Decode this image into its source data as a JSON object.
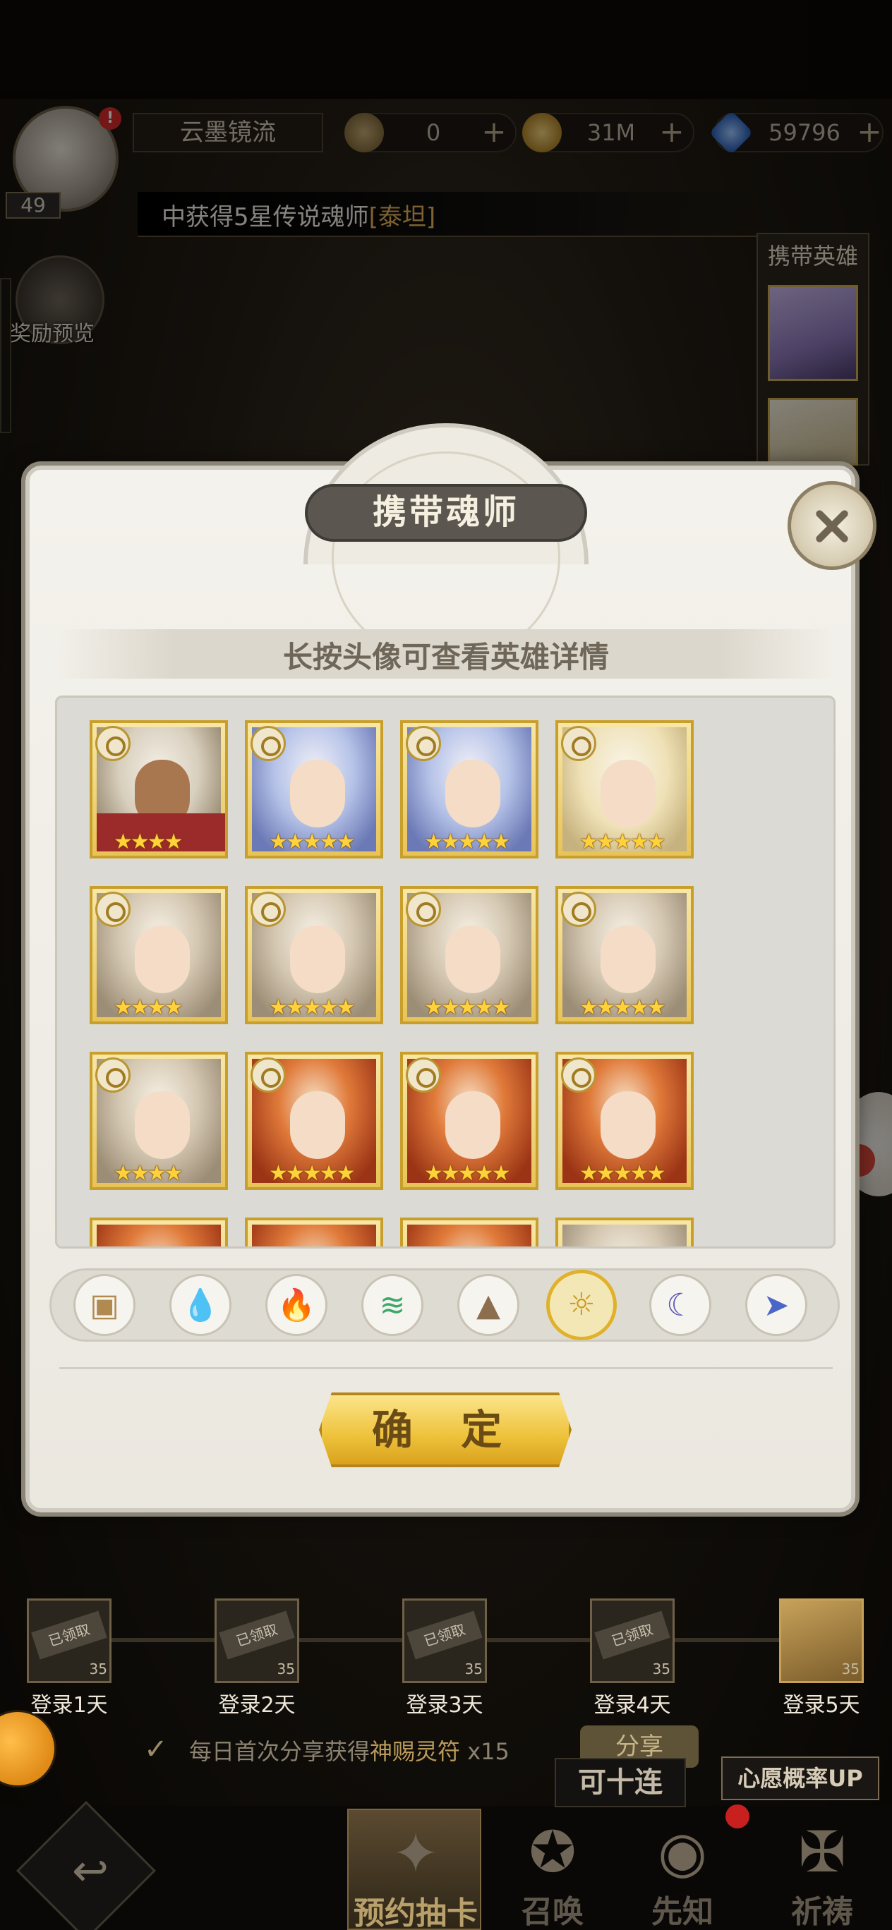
{
  "player": {
    "name": "云墨镜流",
    "level": "49"
  },
  "resources": [
    {
      "icon": "token-coin-icon",
      "value": "0",
      "color": "#8f7a4d"
    },
    {
      "icon": "gold-coin-icon",
      "value": "31M",
      "color": "#b8923c"
    },
    {
      "icon": "diamond-icon",
      "value": "59796",
      "color": "#4f8bd6"
    }
  ],
  "ticker": {
    "prefix": "中获得5星传说魂师",
    "highlight": "[泰坦]"
  },
  "reward_preview": {
    "label": "奖励预览"
  },
  "side_panel": {
    "title": "携带英雄"
  },
  "modal": {
    "title": "携带魂师",
    "hint": "长按头像可查看英雄详情",
    "confirm_label": "确 定",
    "heroes": [
      {
        "portrait": "white-haired-warrior",
        "stars": "★★★★",
        "element": "light"
      },
      {
        "portrait": "blue-haired-girl",
        "stars": "★★★★★",
        "element": "light"
      },
      {
        "portrait": "blue-haired-girl",
        "stars": "★★★★★",
        "element": "light"
      },
      {
        "portrait": "blonde-girl",
        "stars": "★★★★★",
        "element": "light"
      },
      {
        "portrait": "silver-haired-man",
        "stars": "★★★★",
        "element": "light"
      },
      {
        "portrait": "silver-haired-man",
        "stars": "★★★★★",
        "element": "light"
      },
      {
        "portrait": "silver-haired-man",
        "stars": "★★★★★",
        "element": "light"
      },
      {
        "portrait": "silver-haired-man",
        "stars": "★★★★★",
        "element": "light"
      },
      {
        "portrait": "silver-haired-man",
        "stars": "★★★★",
        "element": "light"
      },
      {
        "portrait": "red-haired-man",
        "stars": "★★★★★",
        "element": "light"
      },
      {
        "portrait": "red-haired-man",
        "stars": "★★★★★",
        "element": "light"
      },
      {
        "portrait": "red-haired-man",
        "stars": "★★★★★",
        "element": "light"
      }
    ],
    "filters": [
      {
        "name": "all-box-icon",
        "glyph": "▣",
        "color": "#b08a4e",
        "active": false
      },
      {
        "name": "water-drop-icon",
        "glyph": "💧",
        "color": "#3b7ed6",
        "active": false
      },
      {
        "name": "fire-icon",
        "glyph": "🔥",
        "color": "#d84a3a",
        "active": false
      },
      {
        "name": "wind-icon",
        "glyph": "≋",
        "color": "#3aa86a",
        "active": false
      },
      {
        "name": "earth-mountain-icon",
        "glyph": "▲",
        "color": "#8c6e4e",
        "active": false
      },
      {
        "name": "light-sun-icon",
        "glyph": "☼",
        "color": "#c79a22",
        "active": true
      },
      {
        "name": "dark-moon-icon",
        "glyph": "☾",
        "color": "#5a58b6",
        "active": false
      },
      {
        "name": "special-arrow-icon",
        "glyph": "➤",
        "color": "#4a66c8",
        "active": false
      }
    ]
  },
  "login_rewards": [
    {
      "label": "登录1天",
      "tag": "已领取",
      "count": "35"
    },
    {
      "label": "登录2天",
      "tag": "已领取",
      "count": "35"
    },
    {
      "label": "登录3天",
      "tag": "已领取",
      "count": "35"
    },
    {
      "label": "登录4天",
      "tag": "已领取",
      "count": "35"
    },
    {
      "label": "登录5天",
      "tag": "",
      "count": "35"
    }
  ],
  "share": {
    "text_prefix": "每日首次分享获得",
    "text_highlight": "神赐灵符",
    "text_suffix": " x15",
    "button": "分享"
  },
  "banners": {
    "ten_pull": "可十连",
    "wish_rate": "心愿概率UP"
  },
  "nav": [
    {
      "label": "预约抽卡",
      "glyph": "✦",
      "active": true
    },
    {
      "label": "召唤",
      "glyph": "✪",
      "active": false
    },
    {
      "label": "先知",
      "glyph": "◉",
      "active": false
    },
    {
      "label": "祈祷",
      "glyph": "✠",
      "active": false
    }
  ]
}
